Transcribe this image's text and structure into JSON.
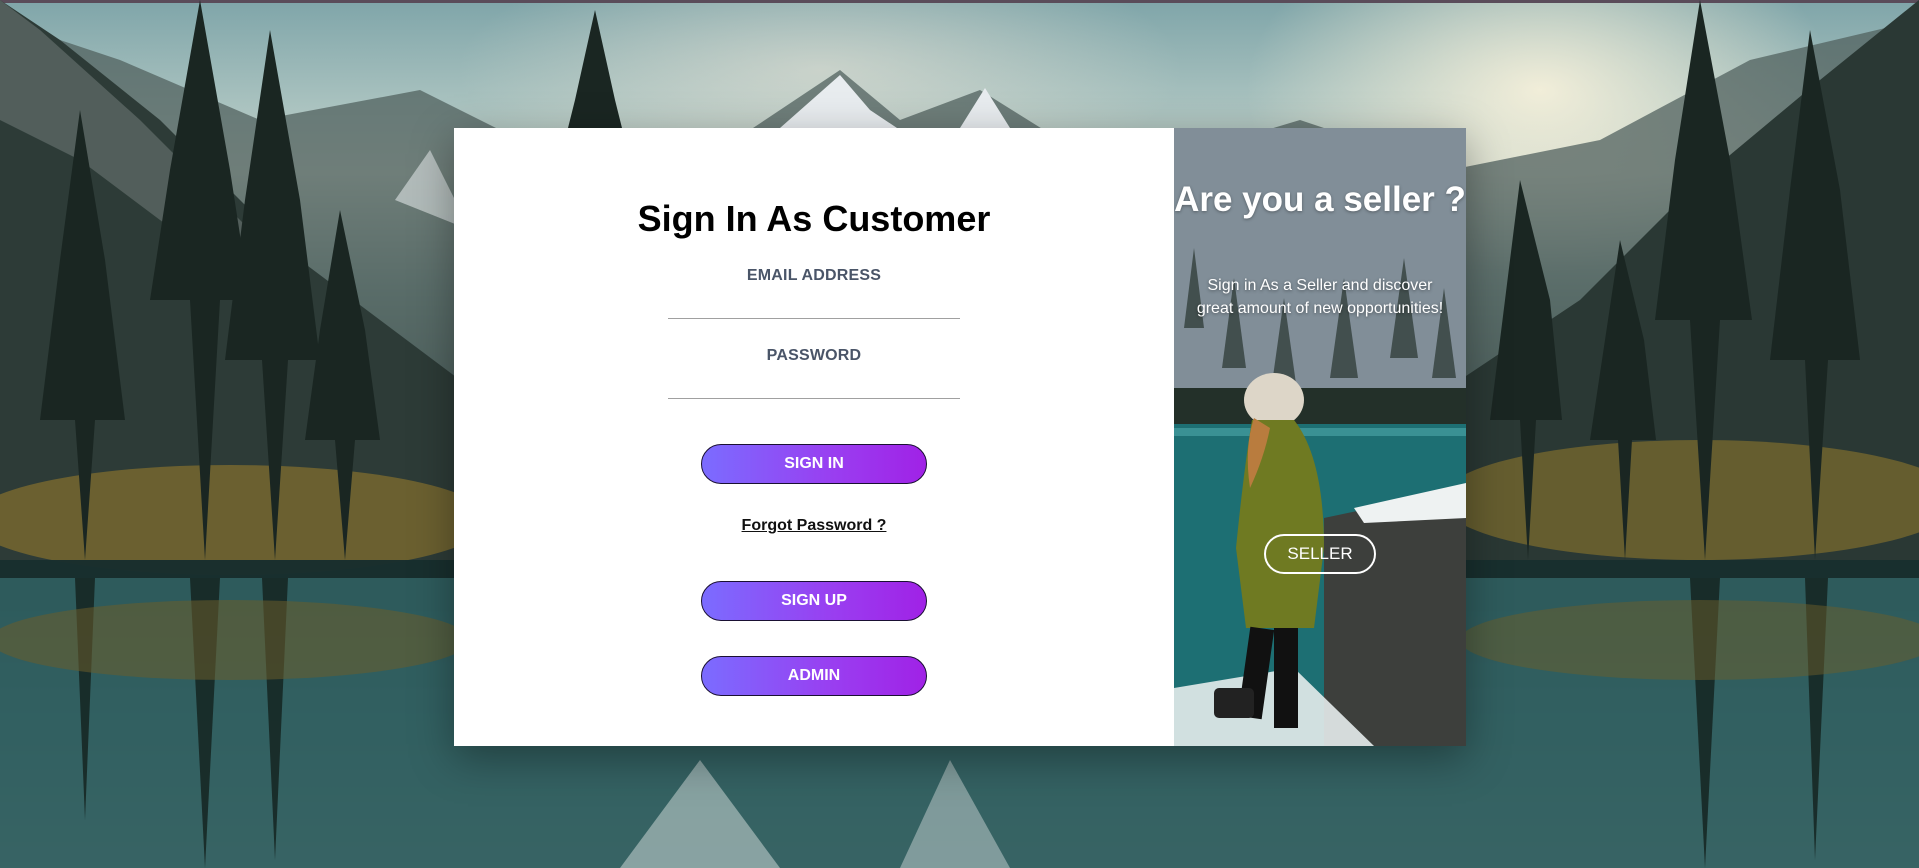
{
  "login": {
    "title": "Sign In As Customer",
    "email_label": "EMAIL ADDRESS",
    "email_value": "",
    "password_label": "PASSWORD",
    "password_value": "",
    "signin_label": "SIGN IN",
    "forgot_label": "Forgot Password ?",
    "signup_label": "SIGN UP",
    "admin_label": "ADMIN"
  },
  "seller_panel": {
    "heading": "Are you a seller ?",
    "text": "Sign in As a Seller and discover great amount of new opportunities!",
    "button_label": "SELLER"
  },
  "colors": {
    "button_gradient_start": "#7b6cff",
    "button_gradient_end": "#a022e6",
    "label_color": "#4a5568",
    "lake_teal": "#1d6f73"
  }
}
